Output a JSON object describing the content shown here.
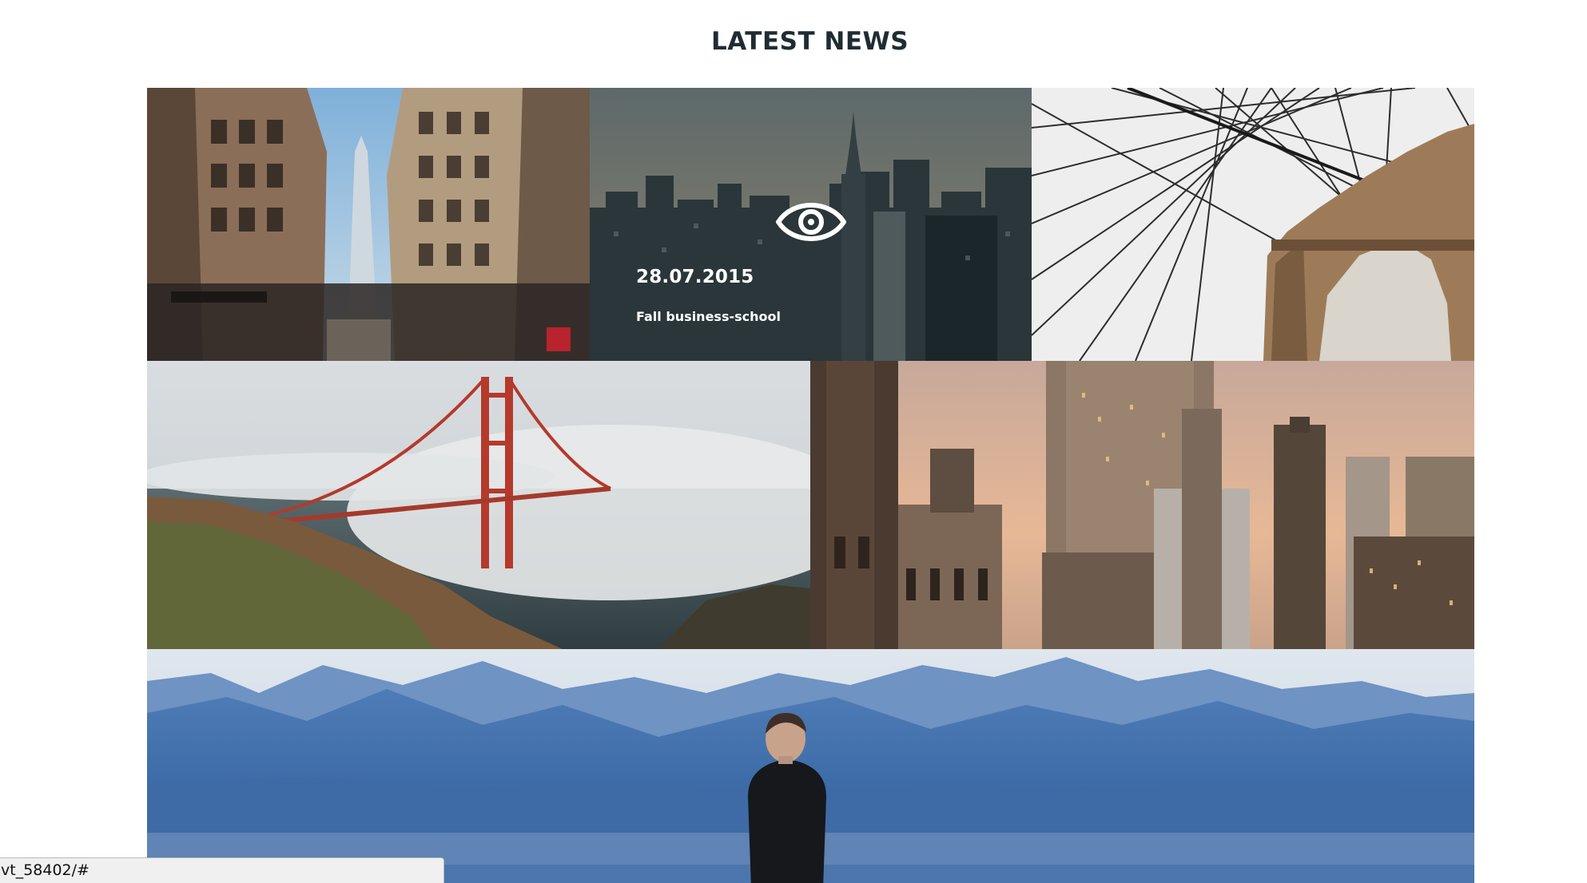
{
  "section": {
    "title": "LATEST NEWS"
  },
  "tiles": [
    {
      "scene": "nyc-street-skyscrapers"
    },
    {
      "scene": "nyc-skyline-aerial",
      "hover": true,
      "date": "28.07.2015",
      "title": "Fall business-school",
      "icon": "eye-icon"
    },
    {
      "scene": "bridge-cables-arch"
    },
    {
      "scene": "golden-gate-bridge-fog"
    },
    {
      "scene": "city-towers-sunset"
    },
    {
      "scene": "man-facing-blue-mountains"
    }
  ],
  "status_bar": {
    "url": "vt_58402/#"
  },
  "colors": {
    "title": "#1f2d33",
    "overlay": "rgba(20,30,35,0.45)",
    "overlay_text": "#ffffff"
  }
}
